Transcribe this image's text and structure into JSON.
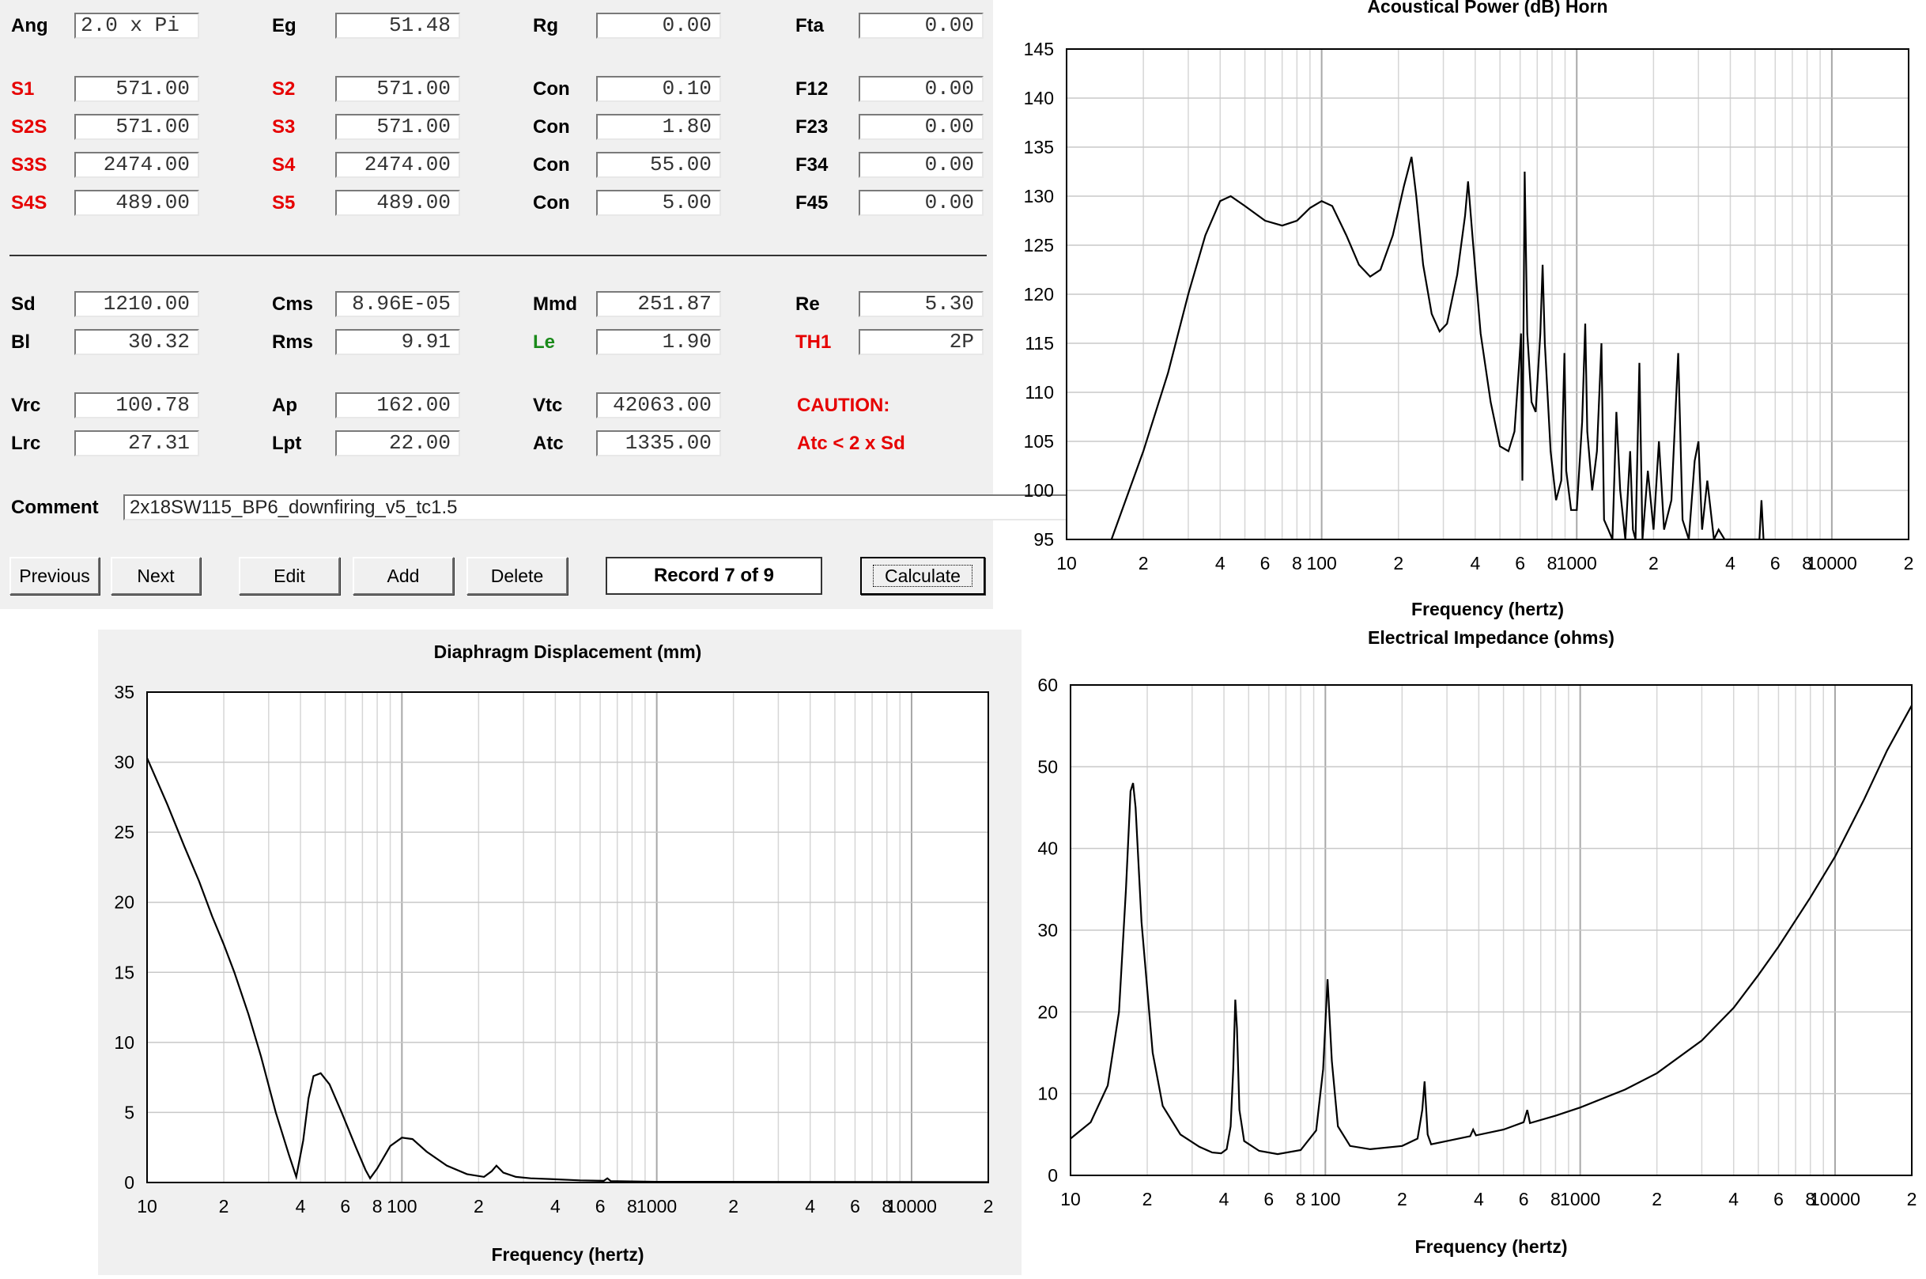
{
  "form": {
    "row1": [
      {
        "label": "Ang",
        "value": "2.0 x Pi",
        "color": "black",
        "left": true
      },
      {
        "label": "Eg",
        "value": "51.48",
        "color": "black"
      },
      {
        "label": "Rg",
        "value": "0.00",
        "color": "black"
      },
      {
        "label": "Fta",
        "value": "0.00",
        "color": "black"
      }
    ],
    "rows": [
      [
        {
          "label": "S1",
          "value": "571.00",
          "color": "red"
        },
        {
          "label": "S2",
          "value": "571.00",
          "color": "red"
        },
        {
          "label": "Con",
          "value": "0.10",
          "color": "black"
        },
        {
          "label": "F12",
          "value": "0.00",
          "color": "black"
        }
      ],
      [
        {
          "label": "S2S",
          "value": "571.00",
          "color": "red"
        },
        {
          "label": "S3",
          "value": "571.00",
          "color": "red"
        },
        {
          "label": "Con",
          "value": "1.80",
          "color": "black"
        },
        {
          "label": "F23",
          "value": "0.00",
          "color": "black"
        }
      ],
      [
        {
          "label": "S3S",
          "value": "2474.00",
          "color": "red"
        },
        {
          "label": "S4",
          "value": "2474.00",
          "color": "red"
        },
        {
          "label": "Con",
          "value": "55.00",
          "color": "black"
        },
        {
          "label": "F34",
          "value": "0.00",
          "color": "black"
        }
      ],
      [
        {
          "label": "S4S",
          "value": "489.00",
          "color": "red"
        },
        {
          "label": "S5",
          "value": "489.00",
          "color": "red"
        },
        {
          "label": "Con",
          "value": "5.00",
          "color": "black"
        },
        {
          "label": "F45",
          "value": "0.00",
          "color": "black"
        }
      ]
    ],
    "driver1": [
      {
        "label": "Sd",
        "value": "1210.00",
        "color": "black"
      },
      {
        "label": "Cms",
        "value": "8.96E-05",
        "color": "black"
      },
      {
        "label": "Mmd",
        "value": "251.87",
        "color": "black"
      },
      {
        "label": "Re",
        "value": "5.30",
        "color": "black"
      }
    ],
    "driver2": [
      {
        "label": "Bl",
        "value": "30.32",
        "color": "black"
      },
      {
        "label": "Rms",
        "value": "9.91",
        "color": "black"
      },
      {
        "label": "Le",
        "value": "1.90",
        "color": "green"
      },
      {
        "label": "TH1",
        "value": "2P",
        "color": "red"
      }
    ],
    "box1": [
      {
        "label": "Vrc",
        "value": "100.78",
        "color": "black"
      },
      {
        "label": "Ap",
        "value": "162.00",
        "color": "black"
      },
      {
        "label": "Vtc",
        "value": "42063.00",
        "color": "black"
      }
    ],
    "box2": [
      {
        "label": "Lrc",
        "value": "27.31",
        "color": "black"
      },
      {
        "label": "Lpt",
        "value": "22.00",
        "color": "black"
      },
      {
        "label": "Atc",
        "value": "1335.00",
        "color": "black"
      }
    ],
    "caution": "CAUTION:",
    "caution_detail": "Atc < 2 x Sd",
    "comment_label": "Comment",
    "comment_value": "2x18SW115_BP6_downfiring_v5_tc1.5"
  },
  "buttons": {
    "previous": "Previous",
    "next": "Next",
    "edit": "Edit",
    "add": "Add",
    "delete": "Delete",
    "record": "Record 7 of 9",
    "calculate": "Calculate"
  },
  "chart_data": [
    {
      "type": "line",
      "title": "Acoustical Power (dB)   Horn",
      "xlabel": "Frequency (hertz)",
      "x_scale": "log",
      "xlim": [
        10,
        20000
      ],
      "ylim": [
        95,
        145
      ],
      "yticks": [
        95,
        100,
        105,
        110,
        115,
        120,
        125,
        130,
        135,
        140,
        145
      ],
      "xtick_labels": [
        "10",
        "2",
        "4",
        "6",
        "8",
        "100",
        "2",
        "4",
        "6",
        "8",
        "1000",
        "2",
        "4",
        "6",
        "8",
        "10000",
        "2"
      ],
      "series": [
        {
          "points": [
            [
              15,
              95
            ],
            [
              20,
              104
            ],
            [
              25,
              112
            ],
            [
              30,
              120
            ],
            [
              35,
              126
            ],
            [
              40,
              129.5
            ],
            [
              44,
              130
            ],
            [
              50,
              129
            ],
            [
              60,
              127.5
            ],
            [
              70,
              127
            ],
            [
              80,
              127.5
            ],
            [
              90,
              128.8
            ],
            [
              100,
              129.5
            ],
            [
              110,
              129
            ],
            [
              125,
              126
            ],
            [
              140,
              123
            ],
            [
              155,
              121.8
            ],
            [
              170,
              122.5
            ],
            [
              190,
              126
            ],
            [
              210,
              131
            ],
            [
              225,
              134
            ],
            [
              235,
              130
            ],
            [
              250,
              123
            ],
            [
              270,
              118
            ],
            [
              290,
              116.2
            ],
            [
              310,
              117
            ],
            [
              340,
              122
            ],
            [
              365,
              128
            ],
            [
              375,
              131.5
            ],
            [
              390,
              126
            ],
            [
              420,
              116
            ],
            [
              460,
              109
            ],
            [
              500,
              104.5
            ],
            [
              540,
              104
            ],
            [
              570,
              106
            ],
            [
              595,
              113
            ],
            [
              605,
              116
            ],
            [
              612,
              101
            ],
            [
              625,
              132.5
            ],
            [
              640,
              116
            ],
            [
              665,
              109
            ],
            [
              690,
              108
            ],
            [
              720,
              116
            ],
            [
              735,
              123
            ],
            [
              750,
              115
            ],
            [
              790,
              104
            ],
            [
              830,
              99
            ],
            [
              870,
              101
            ],
            [
              895,
              114
            ],
            [
              910,
              102
            ],
            [
              950,
              98
            ],
            [
              1000,
              98
            ],
            [
              1050,
              107
            ],
            [
              1080,
              117
            ],
            [
              1100,
              106
            ],
            [
              1150,
              100
            ],
            [
              1200,
              104
            ],
            [
              1250,
              115
            ],
            [
              1280,
              97
            ],
            [
              1330,
              96
            ],
            [
              1380,
              95
            ],
            [
              1430,
              108
            ],
            [
              1480,
              100
            ],
            [
              1550,
              95
            ],
            [
              1620,
              104
            ],
            [
              1660,
              96
            ],
            [
              1700,
              95
            ],
            [
              1760,
              113
            ],
            [
              1810,
              95
            ],
            [
              1900,
              102
            ],
            [
              2000,
              96
            ],
            [
              2100,
              105
            ],
            [
              2200,
              96
            ],
            [
              2350,
              99
            ],
            [
              2500,
              114
            ],
            [
              2600,
              97
            ],
            [
              2750,
              95
            ],
            [
              2900,
              103
            ],
            [
              3000,
              105
            ],
            [
              3100,
              96
            ],
            [
              3250,
              101
            ],
            [
              3450,
              95
            ],
            [
              3600,
              96
            ],
            [
              3800,
              95
            ],
            [
              5200,
              95
            ],
            [
              5300,
              99
            ],
            [
              5400,
              95
            ]
          ]
        }
      ]
    },
    {
      "type": "line",
      "title": "Diaphragm Displacement (mm)",
      "xlabel": "Frequency (hertz)",
      "x_scale": "log",
      "xlim": [
        10,
        20000
      ],
      "ylim": [
        0,
        35
      ],
      "yticks": [
        0,
        5,
        10,
        15,
        20,
        25,
        30,
        35
      ],
      "xtick_labels": [
        "10",
        "2",
        "4",
        "6",
        "8",
        "100",
        "2",
        "4",
        "6",
        "8",
        "1000",
        "2",
        "4",
        "6",
        "8",
        "10000",
        "2"
      ],
      "series": [
        {
          "points": [
            [
              10,
              30.3
            ],
            [
              12,
              27
            ],
            [
              14,
              24
            ],
            [
              16,
              21.5
            ],
            [
              18,
              19
            ],
            [
              20,
              17
            ],
            [
              22,
              15
            ],
            [
              25,
              12
            ],
            [
              28,
              9
            ],
            [
              32,
              5
            ],
            [
              36,
              2
            ],
            [
              38.5,
              0.4
            ],
            [
              41,
              3
            ],
            [
              43,
              6
            ],
            [
              45,
              7.6
            ],
            [
              48,
              7.8
            ],
            [
              52,
              7
            ],
            [
              58,
              5
            ],
            [
              66,
              2.5
            ],
            [
              72,
              0.9
            ],
            [
              75,
              0.3
            ],
            [
              80,
              1
            ],
            [
              90,
              2.6
            ],
            [
              100,
              3.2
            ],
            [
              110,
              3.1
            ],
            [
              125,
              2.2
            ],
            [
              150,
              1.2
            ],
            [
              180,
              0.6
            ],
            [
              210,
              0.4
            ],
            [
              225,
              0.8
            ],
            [
              235,
              1.2
            ],
            [
              250,
              0.7
            ],
            [
              280,
              0.4
            ],
            [
              320,
              0.3
            ],
            [
              380,
              0.25
            ],
            [
              500,
              0.15
            ],
            [
              620,
              0.12
            ],
            [
              640,
              0.3
            ],
            [
              660,
              0.1
            ],
            [
              1000,
              0.05
            ],
            [
              20000,
              0.03
            ]
          ]
        }
      ]
    },
    {
      "type": "line",
      "title": "Electrical Impedance (ohms)",
      "xlabel": "Frequency (hertz)",
      "x_scale": "log",
      "xlim": [
        10,
        20000
      ],
      "ylim": [
        0,
        60
      ],
      "yticks": [
        0,
        10,
        20,
        30,
        40,
        50,
        60
      ],
      "xtick_labels": [
        "10",
        "2",
        "4",
        "6",
        "8",
        "100",
        "2",
        "4",
        "6",
        "8",
        "1000",
        "2",
        "4",
        "6",
        "8",
        "10000",
        "2"
      ],
      "series": [
        {
          "points": [
            [
              10,
              4.5
            ],
            [
              12,
              6.5
            ],
            [
              14,
              11
            ],
            [
              15.5,
              20
            ],
            [
              16.5,
              35
            ],
            [
              17.2,
              47
            ],
            [
              17.6,
              48
            ],
            [
              18,
              45
            ],
            [
              19,
              31
            ],
            [
              21,
              15
            ],
            [
              23,
              8.5
            ],
            [
              27,
              5
            ],
            [
              32,
              3.5
            ],
            [
              36,
              2.8
            ],
            [
              39,
              2.7
            ],
            [
              41,
              3.2
            ],
            [
              42.5,
              6
            ],
            [
              43.5,
              13
            ],
            [
              44.3,
              21.5
            ],
            [
              45,
              18
            ],
            [
              46,
              8
            ],
            [
              48,
              4.2
            ],
            [
              55,
              3
            ],
            [
              65,
              2.6
            ],
            [
              80,
              3.1
            ],
            [
              92,
              5.5
            ],
            [
              98,
              13
            ],
            [
              102,
              24
            ],
            [
              106,
              14
            ],
            [
              112,
              6
            ],
            [
              125,
              3.6
            ],
            [
              150,
              3.2
            ],
            [
              200,
              3.6
            ],
            [
              230,
              4.5
            ],
            [
              240,
              8
            ],
            [
              245,
              11.5
            ],
            [
              252,
              5
            ],
            [
              260,
              3.8
            ],
            [
              300,
              4.2
            ],
            [
              370,
              4.8
            ],
            [
              380,
              5.6
            ],
            [
              390,
              4.9
            ],
            [
              500,
              5.6
            ],
            [
              600,
              6.5
            ],
            [
              620,
              8
            ],
            [
              635,
              6.4
            ],
            [
              800,
              7.3
            ],
            [
              1000,
              8.3
            ],
            [
              1500,
              10.5
            ],
            [
              2000,
              12.5
            ],
            [
              3000,
              16.5
            ],
            [
              4000,
              20.5
            ],
            [
              5000,
              24.5
            ],
            [
              6000,
              28
            ],
            [
              8000,
              34
            ],
            [
              10000,
              39
            ],
            [
              13000,
              46
            ],
            [
              16000,
              52
            ],
            [
              20000,
              57.5
            ]
          ]
        }
      ]
    }
  ]
}
